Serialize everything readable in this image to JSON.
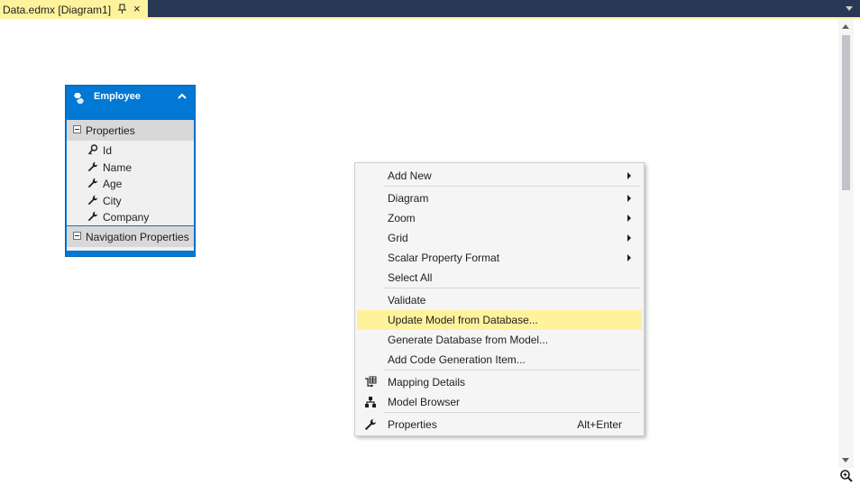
{
  "tab": {
    "title": "Data.edmx [Diagram1]",
    "close": "×"
  },
  "entity": {
    "name": "Employee",
    "properties_header": "Properties",
    "properties": [
      {
        "label": "Id",
        "icon": "key-icon"
      },
      {
        "label": "Name",
        "icon": "wrench-icon"
      },
      {
        "label": "Age",
        "icon": "wrench-icon"
      },
      {
        "label": "City",
        "icon": "wrench-icon"
      },
      {
        "label": "Company",
        "icon": "wrench-icon"
      }
    ],
    "navigation_header": "Navigation Properties"
  },
  "context_menu": {
    "items": [
      {
        "label": "Add New",
        "submenu": true
      },
      {
        "label": "Diagram",
        "submenu": true
      },
      {
        "label": "Zoom",
        "submenu": true
      },
      {
        "label": "Grid",
        "submenu": true
      },
      {
        "label": "Scalar Property Format",
        "submenu": true
      },
      {
        "label": "Select All"
      },
      {
        "label": "Validate"
      },
      {
        "label": "Update Model from Database...",
        "highlighted": true
      },
      {
        "label": "Generate Database from Model..."
      },
      {
        "label": "Add Code Generation Item..."
      },
      {
        "label": "Mapping Details",
        "icon": "mapping-details-icon"
      },
      {
        "label": "Model Browser",
        "icon": "model-browser-icon"
      },
      {
        "label": "Properties",
        "icon": "wrench-icon",
        "shortcut": "Alt+Enter"
      }
    ]
  },
  "colors": {
    "tab_active": "#fff29d",
    "title_bar": "#293955",
    "entity_header": "#0078d4",
    "menu_highlight": "#fff29d"
  }
}
